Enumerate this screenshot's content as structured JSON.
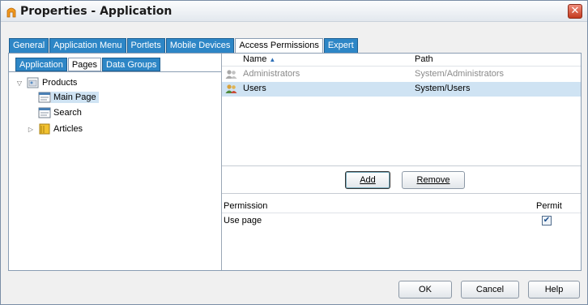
{
  "window": {
    "title": "Properties - Application"
  },
  "main_tabs": [
    {
      "label": "General",
      "active": false
    },
    {
      "label": "Application Menu",
      "active": false
    },
    {
      "label": "Portlets",
      "active": false
    },
    {
      "label": "Mobile Devices",
      "active": false
    },
    {
      "label": "Access Permissions",
      "active": true
    },
    {
      "label": "Expert",
      "active": false
    }
  ],
  "sub_tabs": [
    {
      "label": "Application",
      "active": false
    },
    {
      "label": "Pages",
      "active": true
    },
    {
      "label": "Data Groups",
      "active": false
    }
  ],
  "tree": [
    {
      "label": "Products",
      "icon": "folder-page-icon",
      "toggle": "▽"
    },
    {
      "label": "Main Page",
      "icon": "page-icon",
      "selected": true
    },
    {
      "label": "Search",
      "icon": "page-icon"
    },
    {
      "label": "Articles",
      "icon": "folder-icon",
      "toggle": "▷"
    }
  ],
  "grid": {
    "columns": {
      "name": "Name",
      "path": "Path"
    },
    "sort_icon": "▲",
    "rows": [
      {
        "name": "Administrators",
        "path": "System/Administrators",
        "dim": true,
        "selected": false
      },
      {
        "name": "Users",
        "path": "System/Users",
        "dim": false,
        "selected": true
      }
    ]
  },
  "buttons": {
    "add": "Add",
    "remove": "Remove",
    "ok": "OK",
    "cancel": "Cancel",
    "help": "Help"
  },
  "permissions": {
    "columns": {
      "permission": "Permission",
      "permit": "Permit"
    },
    "rows": [
      {
        "permission": "Use page",
        "permit": true,
        "check_glyph": "✔"
      }
    ]
  },
  "close_glyph": "✕",
  "colors": {
    "tab_blue": "#2d86c6",
    "selection": "#cfe3f3",
    "close_red": "#c33a1e"
  }
}
